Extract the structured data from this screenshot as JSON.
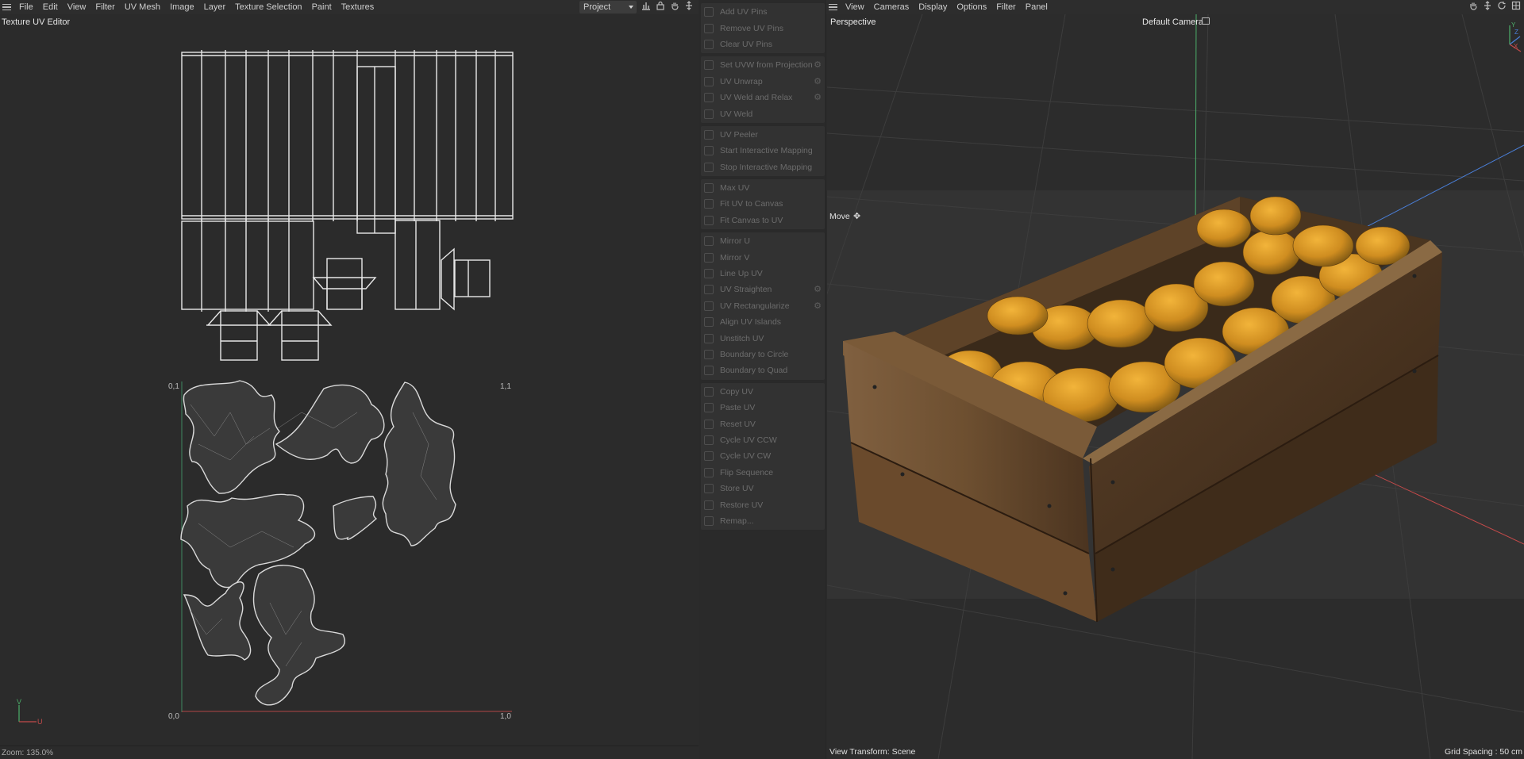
{
  "uv_editor": {
    "menu": [
      "File",
      "Edit",
      "View",
      "Filter",
      "UV Mesh",
      "Image",
      "Layer",
      "Texture Selection",
      "Paint",
      "Textures"
    ],
    "project_select": "Project",
    "title": "Texture UV Editor",
    "zoom": "Zoom: 135.0%",
    "coords": {
      "top_left": "0,1",
      "top_right": "1,1",
      "bottom_left": "0,0",
      "bottom_right": "1,0"
    },
    "axis": {
      "v": "V",
      "u": "U"
    }
  },
  "tool_panel": {
    "groups": [
      [
        {
          "label": "Add UV Pins"
        },
        {
          "label": "Remove UV Pins"
        },
        {
          "label": "Clear UV Pins"
        }
      ],
      [
        {
          "label": "Set UVW from Projection",
          "gear": true
        },
        {
          "label": "UV Unwrap",
          "gear": true
        },
        {
          "label": "UV Weld and Relax",
          "gear": true
        },
        {
          "label": "UV Weld"
        }
      ],
      [
        {
          "label": "UV Peeler"
        },
        {
          "label": "Start Interactive Mapping"
        },
        {
          "label": "Stop Interactive Mapping"
        }
      ],
      [
        {
          "label": "Max UV"
        },
        {
          "label": "Fit UV to Canvas"
        },
        {
          "label": "Fit Canvas to UV"
        }
      ],
      [
        {
          "label": "Mirror U"
        },
        {
          "label": "Mirror V"
        },
        {
          "label": "Line Up UV"
        },
        {
          "label": "UV Straighten",
          "gear": true
        },
        {
          "label": "UV Rectangularize",
          "gear": true
        },
        {
          "label": "Align UV Islands"
        },
        {
          "label": "Unstitch UV"
        },
        {
          "label": "Boundary to Circle"
        },
        {
          "label": "Boundary to Quad"
        }
      ],
      [
        {
          "label": "Copy UV"
        },
        {
          "label": "Paste UV"
        },
        {
          "label": "Reset UV"
        },
        {
          "label": "Cycle UV CCW"
        },
        {
          "label": "Cycle UV CW"
        },
        {
          "label": "Flip Sequence"
        },
        {
          "label": "Store UV"
        },
        {
          "label": "Restore UV"
        },
        {
          "label": "Remap..."
        }
      ]
    ]
  },
  "viewport": {
    "menu": [
      "View",
      "Cameras",
      "Display",
      "Options",
      "Filter",
      "Panel"
    ],
    "projection": "Perspective",
    "camera": "Default Camera",
    "tool": "Move",
    "view_transform": "View Transform: Scene",
    "grid_spacing": "Grid Spacing : 50 cm",
    "axis": {
      "y": "Y",
      "z": "Z",
      "x": "X"
    }
  },
  "colors": {
    "bg": "#2b2b2b",
    "menubar": "#2d2d2d",
    "wood": "#6e4d2c",
    "fruit": "#d39b2a",
    "axis_x": "#c44a4a",
    "axis_y": "#4caf6a",
    "axis_z": "#4a7ed6"
  }
}
